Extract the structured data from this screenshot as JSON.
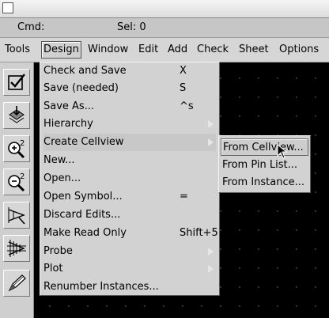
{
  "status": {
    "cmd": "Cmd:",
    "sel": "Sel: 0"
  },
  "menubar": {
    "items": [
      {
        "label": "Tools"
      },
      {
        "label": "Design"
      },
      {
        "label": "Window"
      },
      {
        "label": "Edit"
      },
      {
        "label": "Add"
      },
      {
        "label": "Check"
      },
      {
        "label": "Sheet"
      },
      {
        "label": "Options"
      }
    ],
    "active": "Design"
  },
  "toolbar": {
    "tools": [
      {
        "icon": "check-icon"
      },
      {
        "icon": "save-icon"
      },
      {
        "icon": "zoom-in-icon",
        "badge": "2"
      },
      {
        "icon": "zoom-out-icon",
        "badge": "2"
      },
      {
        "icon": "wire-icon"
      },
      {
        "icon": "bus-icon"
      },
      {
        "icon": "pencil-icon"
      }
    ]
  },
  "design_menu": {
    "items": [
      {
        "label": "Check and Save",
        "accel": "X"
      },
      {
        "label": "Save (needed)",
        "accel": "S"
      },
      {
        "label": "Save As...",
        "accel": "^s"
      },
      {
        "label": "Hierarchy",
        "accel": ""
      },
      {
        "label": "Create Cellview",
        "accel": ""
      },
      {
        "label": "New...",
        "accel": ""
      },
      {
        "label": "Open...",
        "accel": ""
      },
      {
        "label": "Open Symbol...",
        "accel": "="
      },
      {
        "label": "Discard Edits...",
        "accel": ""
      },
      {
        "label": "Make Read Only",
        "accel": "Shift+5"
      },
      {
        "label": "Probe",
        "accel": ""
      },
      {
        "label": "Plot",
        "accel": ""
      },
      {
        "label": "Renumber Instances...",
        "accel": ""
      }
    ]
  },
  "create_cellview_menu": {
    "items": [
      {
        "label": "From Cellview..."
      },
      {
        "label": "From Pin List..."
      },
      {
        "label": "From Instance..."
      }
    ],
    "highlighted": "From Cellview..."
  }
}
